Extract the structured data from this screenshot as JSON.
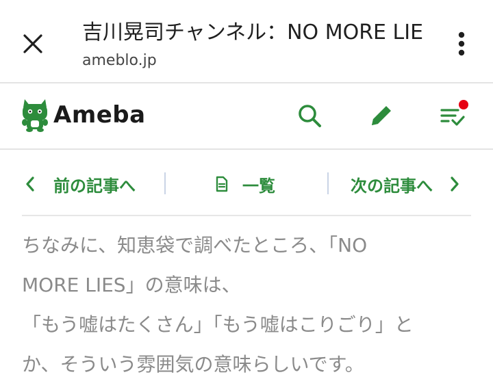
{
  "tab_bar": {
    "title": "吉川晃司チャンネル：NO MORE LIE...",
    "url": "ameblo.jp",
    "close_icon": "close-icon",
    "menu_icon": "more-vert-icon"
  },
  "header": {
    "logo_text": "Ameba",
    "brand_color": "#2d8c3c",
    "notification_color": "#e60012",
    "icons": [
      "search-icon",
      "pencil-icon",
      "checklist-icon"
    ]
  },
  "article_nav": {
    "prev": "前の記事へ",
    "list": "一覧",
    "next": "次の記事へ"
  },
  "article": {
    "lines": [
      "ちなみに、知恵袋で調べたところ、「NO",
      "MORE LIES」の意味は、",
      "「もう嘘はたくさん」「もう嘘はこりごり」と",
      "か、そういう雰囲気の意味らしいです。"
    ]
  }
}
